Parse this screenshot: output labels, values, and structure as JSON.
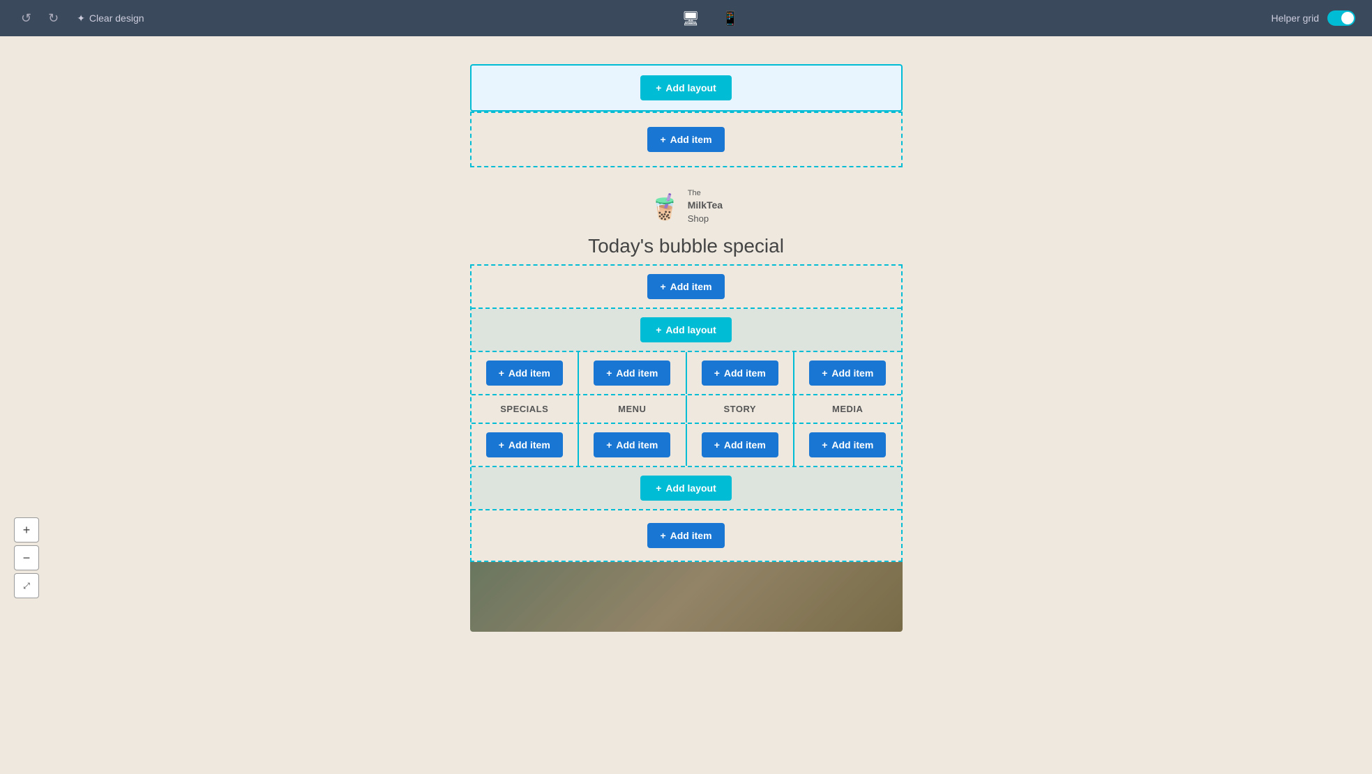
{
  "toolbar": {
    "undo_label": "↺",
    "redo_label": "↻",
    "clear_design_label": "Clear design",
    "desktop_icon": "🖥",
    "tablet_icon": "📱",
    "helper_grid_label": "Helper grid",
    "toggle_state": true
  },
  "canvas": {
    "add_layout_label": "+ Add layout",
    "add_item_label": "+ Add item",
    "brand_name_line1": "The",
    "brand_name_line2": "MilkTea",
    "brand_name_line3": "Shop",
    "page_title": "Today's bubble special",
    "nav_items": [
      "SPECIALS",
      "MENU",
      "STORY",
      "MEDIA"
    ]
  },
  "zoom": {
    "plus_label": "+",
    "minus_label": "−",
    "expand_label": "⤢"
  }
}
